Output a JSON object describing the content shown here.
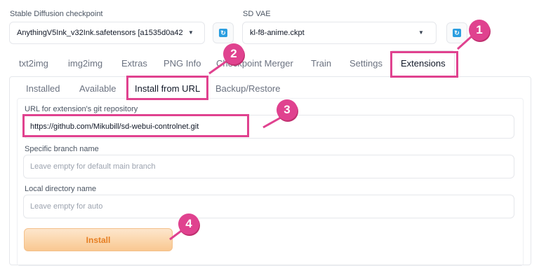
{
  "checkpoint": {
    "label": "Stable Diffusion checkpoint",
    "value": "AnythingV5Ink_v32Ink.safetensors [a1535d0a42",
    "refresh_icon": "refresh-icon"
  },
  "vae": {
    "label": "SD VAE",
    "value": "kl-f8-anime.ckpt",
    "refresh_icon": "refresh-icon"
  },
  "main_tabs": [
    {
      "label": "txt2img"
    },
    {
      "label": "img2img"
    },
    {
      "label": "Extras"
    },
    {
      "label": "PNG Info"
    },
    {
      "label": "Checkpoint Merger"
    },
    {
      "label": "Train"
    },
    {
      "label": "Settings"
    },
    {
      "label": "Extensions"
    }
  ],
  "sub_tabs": [
    {
      "label": "Installed"
    },
    {
      "label": "Available"
    },
    {
      "label": "Install from URL"
    },
    {
      "label": "Backup/Restore"
    }
  ],
  "form": {
    "url_label": "URL for extension's git repository",
    "url_value": "https://github.com/Mikubill/sd-webui-controlnet.git",
    "branch_label": "Specific branch name",
    "branch_placeholder": "Leave empty for default main branch",
    "dir_label": "Local directory name",
    "dir_placeholder": "Leave empty for auto",
    "install_label": "Install"
  },
  "annotations": {
    "color": "#e0428f",
    "steps": [
      "1",
      "2",
      "3",
      "4"
    ]
  }
}
